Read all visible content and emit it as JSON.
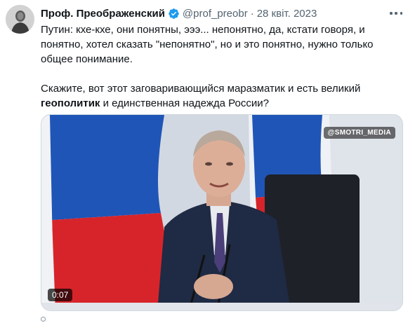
{
  "tweet": {
    "author_name": "Проф. Преображенский",
    "handle": "@prof_preobr",
    "separator": "·",
    "date": "28 квіт. 2023",
    "text_line_1": "Путин: кхе-кхе, они понятны, эээ... непонятно, да, кстати говоря, и",
    "text_line_2": "понятно, хотел сказать \"непонятно\", но и это понятно, нужно только",
    "text_line_3": "общее понимание.",
    "text_line_4": "Скажите, вот этот заговаривающийся маразматик и есть великий",
    "text_line_5_bold": "геополитик",
    "text_line_5_rest": " и единственная надежда России?"
  },
  "media": {
    "watermark": "@SMOTRI_MEDIA",
    "duration": "0:07"
  },
  "icons": {
    "verified": "verified-badge-icon",
    "more": "more-options-icon"
  },
  "colors": {
    "text_primary": "#0f1419",
    "text_secondary": "#536471",
    "verified_blue": "#1d9bf0"
  }
}
